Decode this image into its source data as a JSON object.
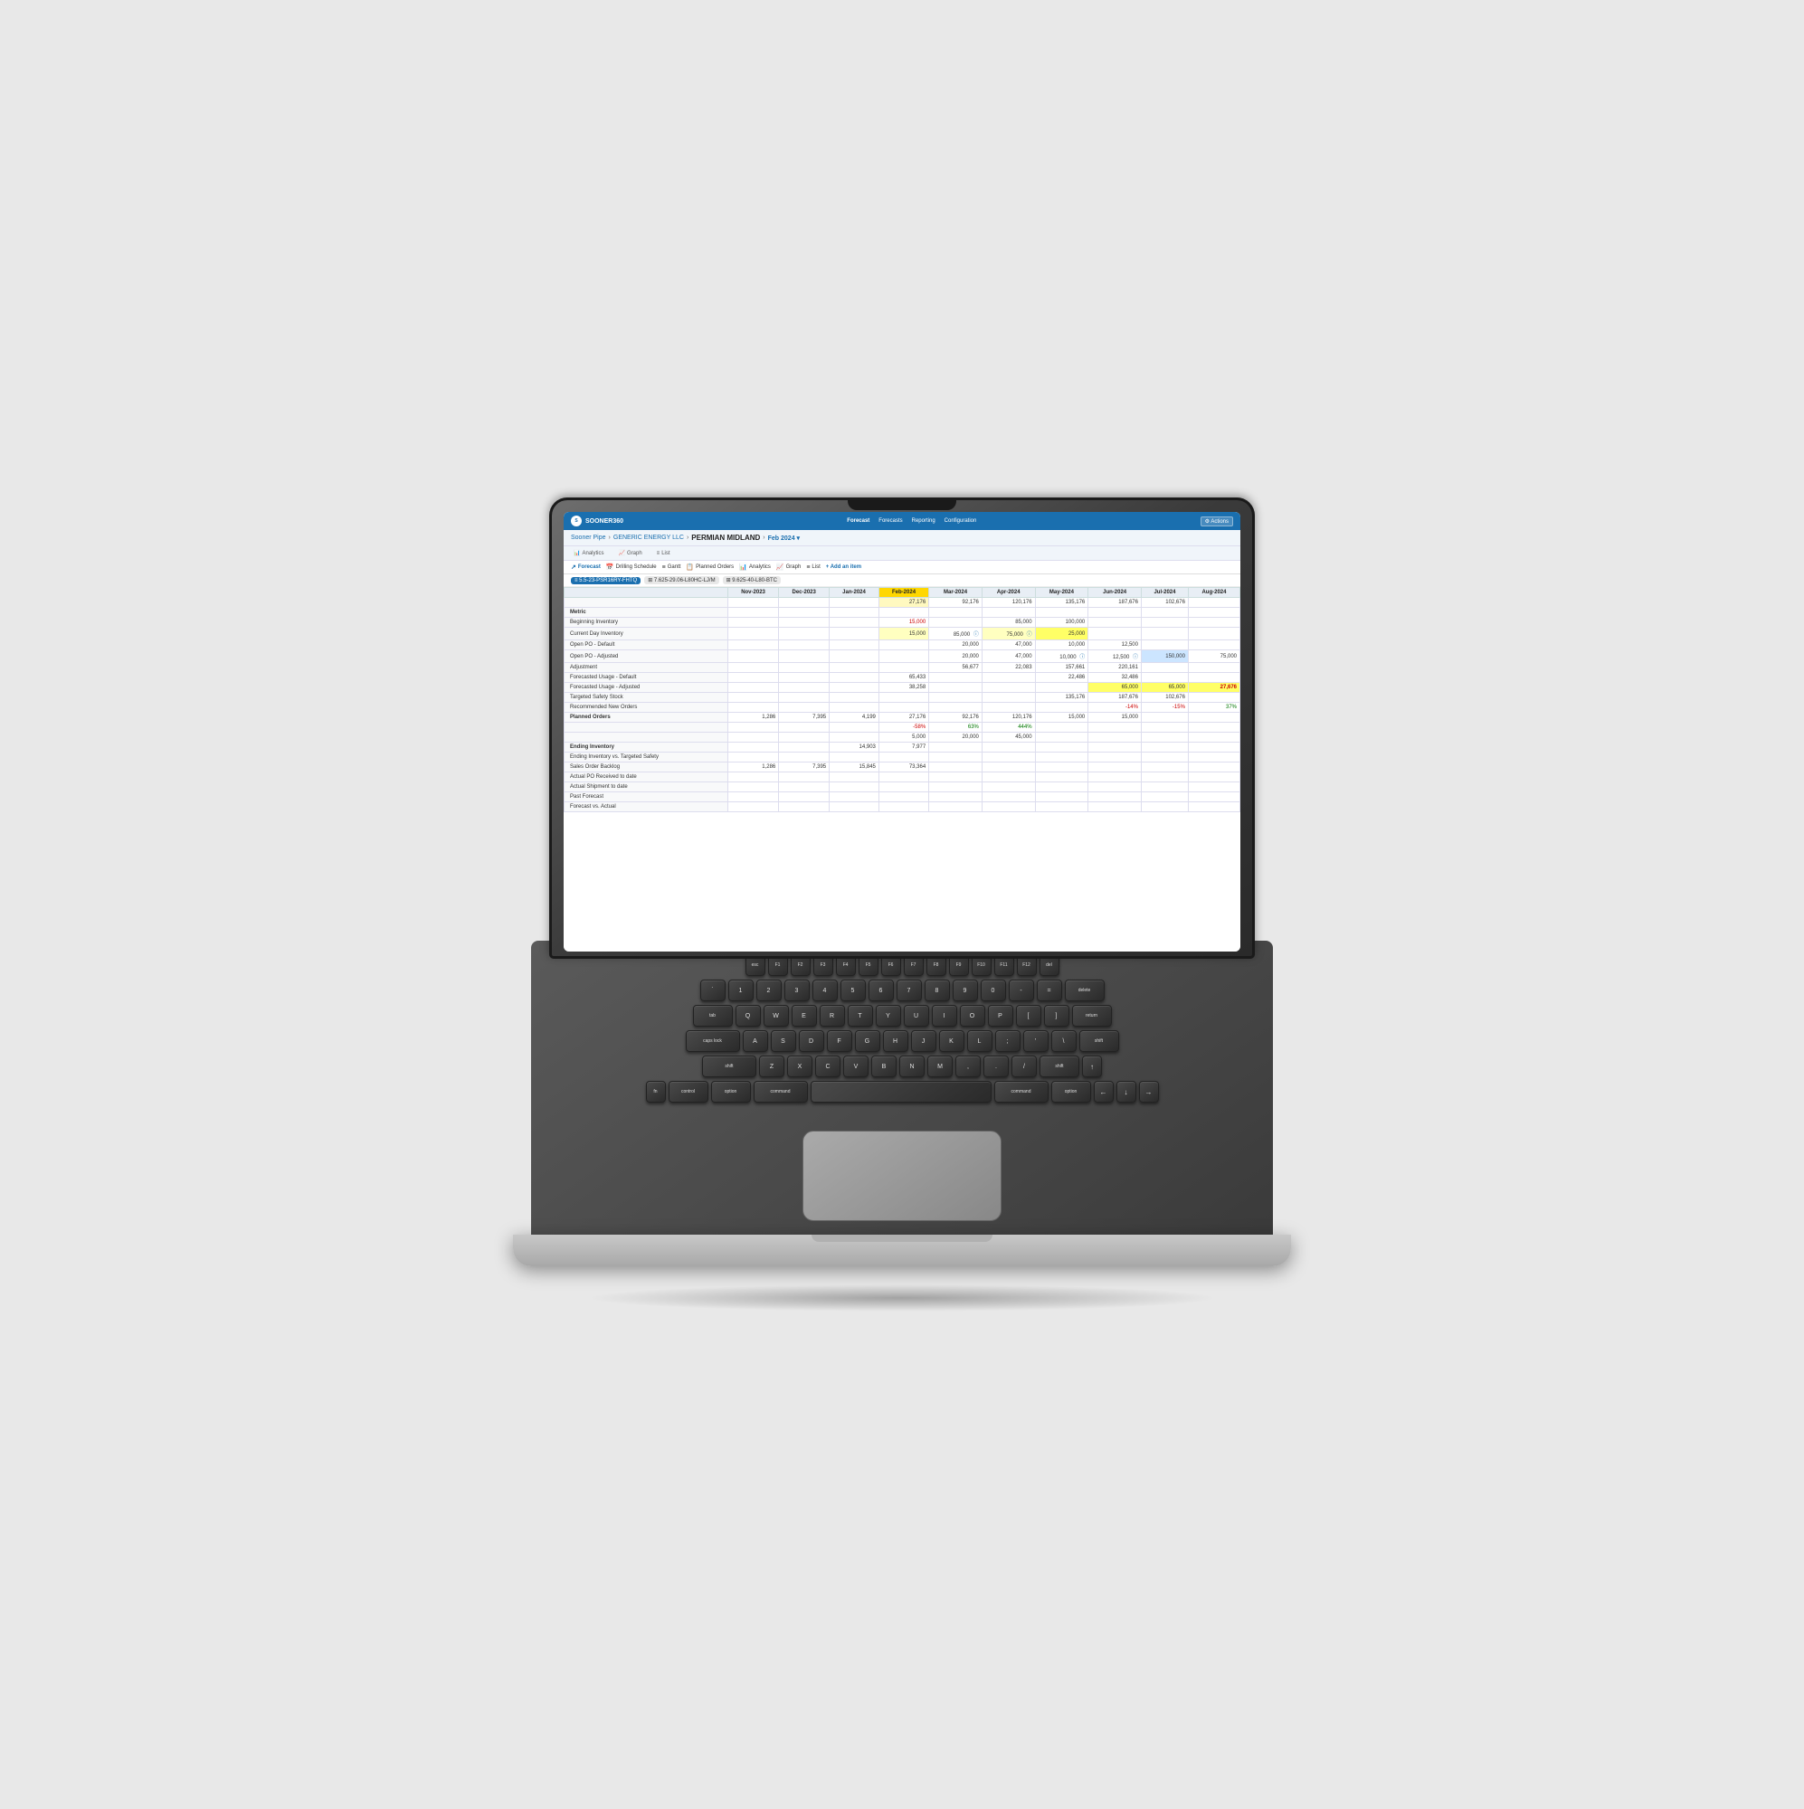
{
  "app": {
    "logo": "S",
    "brand": "SOONER360",
    "nav_items": [
      "Forecast",
      "Forecasts",
      "Reporting",
      "Configuration"
    ],
    "actions_label": "⚙ Actions"
  },
  "breadcrumb": {
    "items": [
      "Sooner Pipe",
      "GENERIC ENERGY LLC",
      "PERMIAN MIDLAND"
    ],
    "date": "Feb 2024 ▾"
  },
  "sub_nav": {
    "items": [
      "Analytics",
      "Graph",
      "List"
    ]
  },
  "toolbar": {
    "items": [
      "✓ Forecast",
      "📅 Drilling Schedule",
      "≡ Gantt",
      "📋 Planned Orders",
      "📊 Analytics",
      "📈 Graph",
      "≡ List"
    ],
    "add_item": "+ Add an item"
  },
  "tags": {
    "active": "≡ 5.5-23-PSR16RY-FHTQ",
    "inactive": [
      "⊞ 7.625-29.06-L80HC-LJ/M",
      "⊞ 9.625-40-L80-BTC"
    ]
  },
  "table": {
    "months": [
      "Nov-2023",
      "Dec-2023",
      "Jan-2024",
      "Feb-2024",
      "Mar-2024",
      "Apr-2024",
      "May-2024",
      "Jun-2024",
      "Jul-2024",
      "Aug-2024"
    ],
    "top_row": [
      "",
      "",
      "",
      "27,176",
      "92,176",
      "120,176",
      "135,176",
      "187,676",
      "102,676"
    ],
    "metrics": [
      {
        "label": "Metric",
        "is_header": true,
        "values": [
          "",
          "",
          "",
          "",
          "",
          "",
          "",
          "",
          "",
          ""
        ]
      },
      {
        "label": "Beginning Inventory",
        "values": [
          "",
          "",
          "",
          "15,000",
          "",
          "85,000",
          "100,000",
          "",
          "",
          ""
        ]
      },
      {
        "label": "Current Day Inventory",
        "values": [
          "",
          "",
          "",
          "15,000",
          "85,000 ⓘ",
          "75,000 ⓘ",
          "25,000",
          "",
          "",
          ""
        ]
      },
      {
        "label": "Open PO - Default",
        "values": [
          "",
          "",
          "",
          "",
          "20,000",
          "47,000",
          "10,000",
          "12,500",
          "",
          ""
        ]
      },
      {
        "label": "Open PO - Adjusted",
        "values": [
          "",
          "",
          "",
          "",
          "20,000",
          "47,000",
          "10,000 ⓘ",
          "12,500 ⓘ",
          "150,000",
          "75,000"
        ]
      },
      {
        "label": "Adjustment",
        "values": [
          "",
          "",
          "",
          "",
          "56,677",
          "22,083",
          "157,661",
          "220,161",
          "",
          ""
        ]
      },
      {
        "label": "Forecasted Usage - Default",
        "values": [
          "",
          "",
          "",
          "65,433",
          "",
          "",
          "22,486",
          "32,486",
          "",
          ""
        ]
      },
      {
        "label": "Forecasted Usage - Adjusted",
        "values": [
          "",
          "",
          "",
          "38,258",
          "",
          "",
          "",
          "65,000",
          "65,000",
          "27,676"
        ]
      },
      {
        "label": "Targeted Safety Stock",
        "values": [
          "",
          "",
          "",
          "",
          "",
          "",
          "135,176",
          "187,676",
          "102,676",
          ""
        ]
      },
      {
        "label": "Recommended New Orders",
        "values": [
          "",
          "",
          "",
          "",
          "",
          "",
          "",
          "-14%",
          "-15%",
          "37%"
        ]
      },
      {
        "label": "Planned Orders",
        "values": [
          "1,286",
          "7,395",
          "4,199",
          "27,176",
          "92,176",
          "120,176",
          "15,000",
          "15,000",
          "",
          ""
        ]
      },
      {
        "label": "",
        "values": [
          "",
          "",
          "",
          "-58%",
          "63%",
          "444%",
          "",
          "",
          "",
          ""
        ]
      },
      {
        "label": "",
        "values": [
          "",
          "",
          "",
          "5,000",
          "20,000",
          "45,000",
          "",
          "",
          "",
          ""
        ]
      },
      {
        "label": "Ending Inventory",
        "is_bold": true,
        "values": [
          "",
          "",
          "",
          "7,977",
          "",
          "",
          "",
          "",
          "",
          ""
        ]
      },
      {
        "label": "Ending Inventory vs. Targeted Safety",
        "values": [
          "",
          "",
          "14,903",
          "",
          "",
          "",
          "",
          "",
          "",
          ""
        ]
      },
      {
        "label": "Sales Order Backlog",
        "values": [
          "1,286",
          "7,395",
          "15,845",
          "73,364",
          "",
          "",
          "",
          "",
          "",
          ""
        ]
      },
      {
        "label": "Actual PO Received to date",
        "values": [
          "",
          "",
          "",
          "",
          "",
          "",
          "",
          "",
          "",
          ""
        ]
      },
      {
        "label": "Actual Shipment to date",
        "values": [
          "",
          "",
          "",
          "",
          "",
          "",
          "",
          "",
          "",
          ""
        ]
      },
      {
        "label": "Past Forecast",
        "values": [
          "",
          "",
          "",
          "",
          "",
          "",
          "",
          "",
          "",
          ""
        ]
      },
      {
        "label": "Forecast vs. Actual",
        "values": [
          "",
          "",
          "",
          "",
          "",
          "",
          "",
          "",
          "",
          ""
        ]
      }
    ]
  }
}
